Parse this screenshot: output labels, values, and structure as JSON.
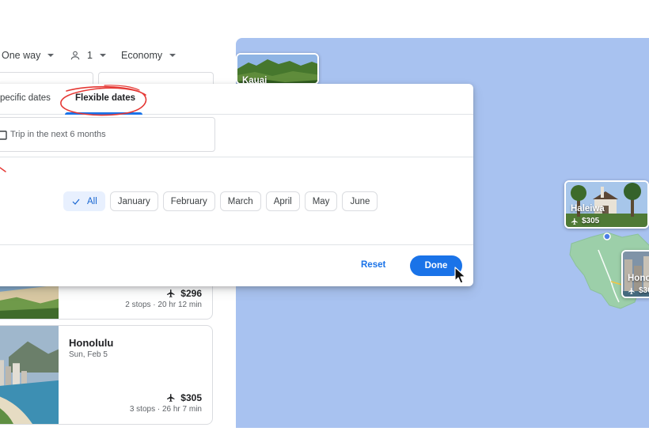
{
  "header": {
    "trip_type": "One way",
    "passengers": "1",
    "cabin_class": "Economy"
  },
  "dialog": {
    "tabs": [
      {
        "label": "pecific dates",
        "active": false
      },
      {
        "label": "Flexible dates",
        "active": true
      }
    ],
    "trip_field_text": "Trip in the next 6 months",
    "month_chips": [
      {
        "label": "All",
        "selected": true
      },
      {
        "label": "January",
        "selected": false
      },
      {
        "label": "February",
        "selected": false
      },
      {
        "label": "March",
        "selected": false
      },
      {
        "label": "April",
        "selected": false
      },
      {
        "label": "May",
        "selected": false
      },
      {
        "label": "June",
        "selected": false
      }
    ],
    "reset_label": "Reset",
    "done_label": "Done"
  },
  "results": [
    {
      "city": "",
      "date": "",
      "price": "$296",
      "stops": "2 stops · 20 hr 12 min"
    },
    {
      "city": "Honolulu",
      "date": "Sun, Feb 5",
      "price": "$305",
      "stops": "3 stops · 26 hr 7 min"
    }
  ],
  "map": {
    "cards": [
      {
        "name": "Kauai",
        "price": ""
      },
      {
        "name": "Haleiwa",
        "price": "$305"
      },
      {
        "name": "Hono",
        "price": "$30"
      }
    ]
  },
  "colors": {
    "accent": "#1a73e8",
    "map_water": "#a8c2f0",
    "land": "#9ccfa9",
    "annotation": "#e53935"
  }
}
